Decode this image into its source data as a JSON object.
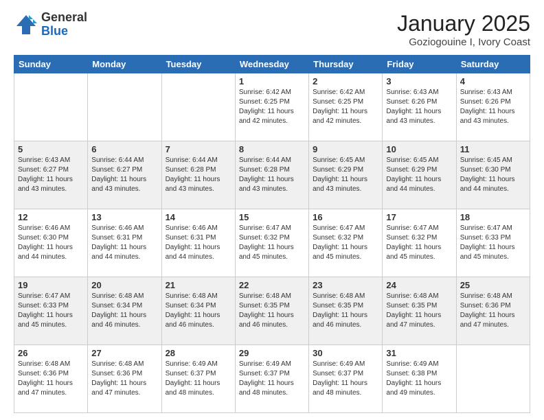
{
  "logo": {
    "general": "General",
    "blue": "Blue"
  },
  "header": {
    "month": "January 2025",
    "location": "Goziogouine I, Ivory Coast"
  },
  "days_of_week": [
    "Sunday",
    "Monday",
    "Tuesday",
    "Wednesday",
    "Thursday",
    "Friday",
    "Saturday"
  ],
  "weeks": [
    [
      {
        "day": "",
        "info": ""
      },
      {
        "day": "",
        "info": ""
      },
      {
        "day": "",
        "info": ""
      },
      {
        "day": "1",
        "info": "Sunrise: 6:42 AM\nSunset: 6:25 PM\nDaylight: 11 hours\nand 42 minutes."
      },
      {
        "day": "2",
        "info": "Sunrise: 6:42 AM\nSunset: 6:25 PM\nDaylight: 11 hours\nand 42 minutes."
      },
      {
        "day": "3",
        "info": "Sunrise: 6:43 AM\nSunset: 6:26 PM\nDaylight: 11 hours\nand 43 minutes."
      },
      {
        "day": "4",
        "info": "Sunrise: 6:43 AM\nSunset: 6:26 PM\nDaylight: 11 hours\nand 43 minutes."
      }
    ],
    [
      {
        "day": "5",
        "info": "Sunrise: 6:43 AM\nSunset: 6:27 PM\nDaylight: 11 hours\nand 43 minutes."
      },
      {
        "day": "6",
        "info": "Sunrise: 6:44 AM\nSunset: 6:27 PM\nDaylight: 11 hours\nand 43 minutes."
      },
      {
        "day": "7",
        "info": "Sunrise: 6:44 AM\nSunset: 6:28 PM\nDaylight: 11 hours\nand 43 minutes."
      },
      {
        "day": "8",
        "info": "Sunrise: 6:44 AM\nSunset: 6:28 PM\nDaylight: 11 hours\nand 43 minutes."
      },
      {
        "day": "9",
        "info": "Sunrise: 6:45 AM\nSunset: 6:29 PM\nDaylight: 11 hours\nand 43 minutes."
      },
      {
        "day": "10",
        "info": "Sunrise: 6:45 AM\nSunset: 6:29 PM\nDaylight: 11 hours\nand 44 minutes."
      },
      {
        "day": "11",
        "info": "Sunrise: 6:45 AM\nSunset: 6:30 PM\nDaylight: 11 hours\nand 44 minutes."
      }
    ],
    [
      {
        "day": "12",
        "info": "Sunrise: 6:46 AM\nSunset: 6:30 PM\nDaylight: 11 hours\nand 44 minutes."
      },
      {
        "day": "13",
        "info": "Sunrise: 6:46 AM\nSunset: 6:31 PM\nDaylight: 11 hours\nand 44 minutes."
      },
      {
        "day": "14",
        "info": "Sunrise: 6:46 AM\nSunset: 6:31 PM\nDaylight: 11 hours\nand 44 minutes."
      },
      {
        "day": "15",
        "info": "Sunrise: 6:47 AM\nSunset: 6:32 PM\nDaylight: 11 hours\nand 45 minutes."
      },
      {
        "day": "16",
        "info": "Sunrise: 6:47 AM\nSunset: 6:32 PM\nDaylight: 11 hours\nand 45 minutes."
      },
      {
        "day": "17",
        "info": "Sunrise: 6:47 AM\nSunset: 6:32 PM\nDaylight: 11 hours\nand 45 minutes."
      },
      {
        "day": "18",
        "info": "Sunrise: 6:47 AM\nSunset: 6:33 PM\nDaylight: 11 hours\nand 45 minutes."
      }
    ],
    [
      {
        "day": "19",
        "info": "Sunrise: 6:47 AM\nSunset: 6:33 PM\nDaylight: 11 hours\nand 45 minutes."
      },
      {
        "day": "20",
        "info": "Sunrise: 6:48 AM\nSunset: 6:34 PM\nDaylight: 11 hours\nand 46 minutes."
      },
      {
        "day": "21",
        "info": "Sunrise: 6:48 AM\nSunset: 6:34 PM\nDaylight: 11 hours\nand 46 minutes."
      },
      {
        "day": "22",
        "info": "Sunrise: 6:48 AM\nSunset: 6:35 PM\nDaylight: 11 hours\nand 46 minutes."
      },
      {
        "day": "23",
        "info": "Sunrise: 6:48 AM\nSunset: 6:35 PM\nDaylight: 11 hours\nand 46 minutes."
      },
      {
        "day": "24",
        "info": "Sunrise: 6:48 AM\nSunset: 6:35 PM\nDaylight: 11 hours\nand 47 minutes."
      },
      {
        "day": "25",
        "info": "Sunrise: 6:48 AM\nSunset: 6:36 PM\nDaylight: 11 hours\nand 47 minutes."
      }
    ],
    [
      {
        "day": "26",
        "info": "Sunrise: 6:48 AM\nSunset: 6:36 PM\nDaylight: 11 hours\nand 47 minutes."
      },
      {
        "day": "27",
        "info": "Sunrise: 6:48 AM\nSunset: 6:36 PM\nDaylight: 11 hours\nand 47 minutes."
      },
      {
        "day": "28",
        "info": "Sunrise: 6:49 AM\nSunset: 6:37 PM\nDaylight: 11 hours\nand 48 minutes."
      },
      {
        "day": "29",
        "info": "Sunrise: 6:49 AM\nSunset: 6:37 PM\nDaylight: 11 hours\nand 48 minutes."
      },
      {
        "day": "30",
        "info": "Sunrise: 6:49 AM\nSunset: 6:37 PM\nDaylight: 11 hours\nand 48 minutes."
      },
      {
        "day": "31",
        "info": "Sunrise: 6:49 AM\nSunset: 6:38 PM\nDaylight: 11 hours\nand 49 minutes."
      },
      {
        "day": "",
        "info": ""
      }
    ]
  ],
  "row_shading": [
    false,
    true,
    false,
    true,
    false
  ]
}
